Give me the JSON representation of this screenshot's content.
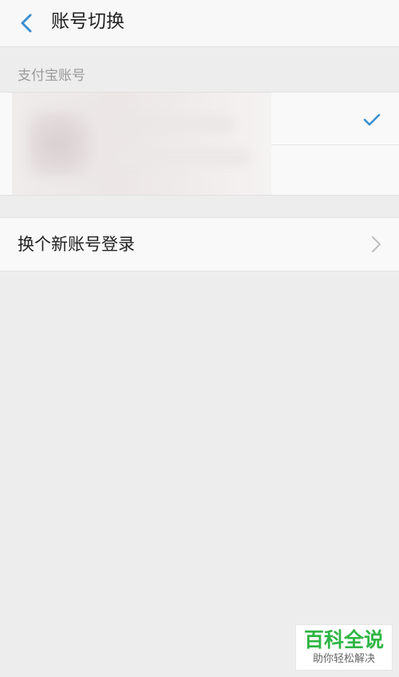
{
  "header": {
    "title": "账号切换"
  },
  "accounts_section": {
    "label": "支付宝账号"
  },
  "new_account": {
    "label": "换个新账号登录"
  },
  "watermark": {
    "main": "百科全说",
    "sub": "助你轻松解决"
  },
  "colors": {
    "accent": "#3a8fd0",
    "watermark_green": "#2fb544"
  },
  "icons": {
    "back": "chevron-left-icon",
    "selected": "checkmark-icon",
    "next": "chevron-right-icon"
  }
}
